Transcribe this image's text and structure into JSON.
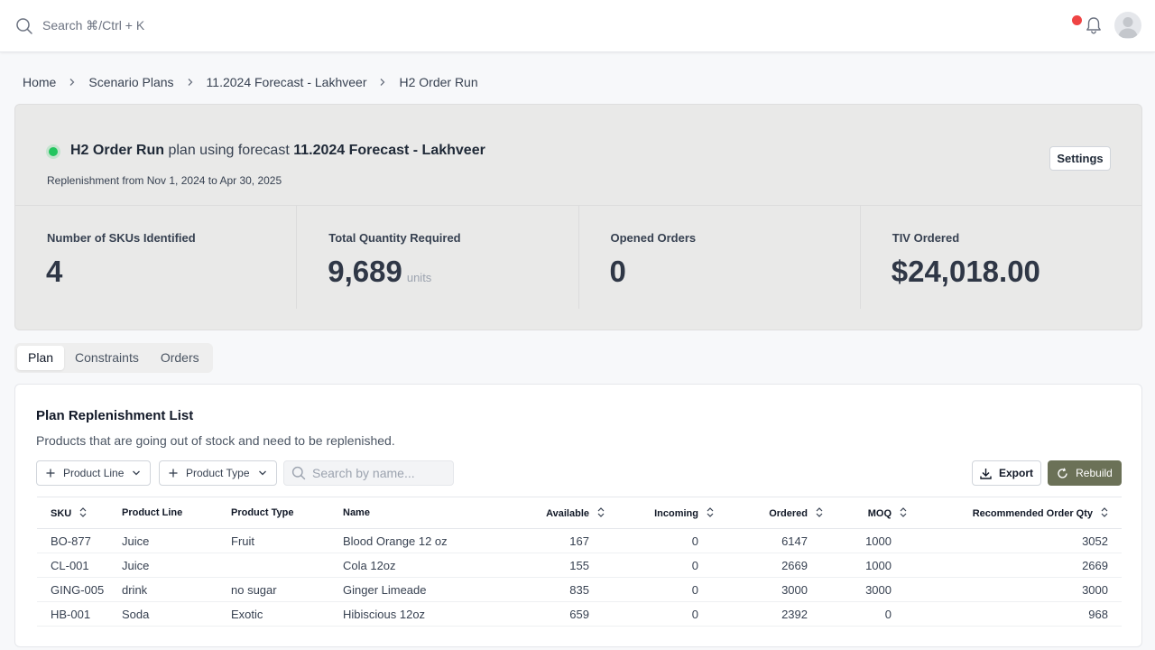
{
  "topbar": {
    "search_placeholder": "Search ⌘/Ctrl + K",
    "icons": [
      "search-icon",
      "bell-icon",
      "avatar-icon"
    ],
    "notification_dot_color": "#ef4444"
  },
  "breadcrumb": [
    "Home",
    "Scenario Plans",
    "11.2024 Forecast - Lakhveer",
    "H2 Order Run"
  ],
  "summary": {
    "plan_name": "H2 Order Run",
    "plan_connector": "plan using forecast",
    "forecast_name": "11.2024 Forecast - Lakhveer",
    "replenishment_range": "Replenishment from Nov 1, 2024 to Apr 30, 2025",
    "settings_label": "Settings",
    "status_color": "#22c55e",
    "stats": [
      {
        "label": "Number of SKUs Identified",
        "value": "4",
        "unit": ""
      },
      {
        "label": "Total Quantity Required",
        "value": "9,689",
        "unit": "units"
      },
      {
        "label": "Opened Orders",
        "value": "0",
        "unit": ""
      },
      {
        "label": "TIV Ordered",
        "value": "$24,018.00",
        "unit": ""
      }
    ]
  },
  "tabs": [
    {
      "label": "Plan",
      "active": true
    },
    {
      "label": "Constraints",
      "active": false
    },
    {
      "label": "Orders",
      "active": false
    }
  ],
  "panel": {
    "title": "Plan Replenishment List",
    "subtitle": "Products that are going out of stock and need to be replenished.",
    "filters": [
      "Product Line",
      "Product Type"
    ],
    "search_placeholder": "Search by name...",
    "export_label": "Export",
    "rebuild_label": "Rebuild",
    "rebuild_color": "#6b7157",
    "columns": [
      "SKU",
      "Product Line",
      "Product Type",
      "Name",
      "Available",
      "Incoming",
      "Ordered",
      "MOQ",
      "Recommended Order Qty"
    ],
    "rows": [
      [
        "BO-877",
        "Juice",
        "Fruit",
        "Blood Orange 12 oz",
        "167",
        "0",
        "6147",
        "1000",
        "3052"
      ],
      [
        "CL-001",
        "Juice",
        "",
        "Cola 12oz",
        "155",
        "0",
        "2669",
        "1000",
        "2669"
      ],
      [
        "GING-005",
        "drink",
        "no sugar",
        "Ginger Limeade",
        "835",
        "0",
        "3000",
        "3000",
        "3000"
      ],
      [
        "HB-001",
        "Soda",
        "Exotic",
        "Hibiscious 12oz",
        "659",
        "0",
        "2392",
        "0",
        "968"
      ]
    ]
  }
}
